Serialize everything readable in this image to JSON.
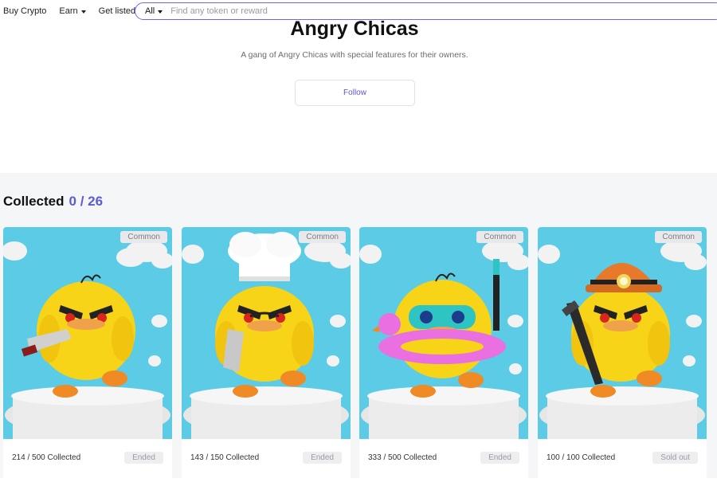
{
  "nav": {
    "items": [
      {
        "label": "Buy Crypto",
        "has_caret": false
      },
      {
        "label": "Earn",
        "has_caret": true
      },
      {
        "label": "Get listed",
        "has_caret": false
      }
    ]
  },
  "search": {
    "filter_value": "All",
    "placeholder": "Find any token or reward"
  },
  "collection": {
    "title": "Angry Chicas",
    "description": "A gang of Angry Chicas with special features for their owners.",
    "follow_label": "Follow"
  },
  "collected": {
    "label": "Collected",
    "count": "0 / 26"
  },
  "cards": [
    {
      "rarity": "Common",
      "collected": "214 / 500 Collected",
      "status": "Ended",
      "accessory": "knife"
    },
    {
      "rarity": "Common",
      "collected": "143 / 150 Collected",
      "status": "Ended",
      "accessory": "chef-hat-cleaver"
    },
    {
      "rarity": "Common",
      "collected": "333 / 500 Collected",
      "status": "Ended",
      "accessory": "snorkel-float"
    },
    {
      "rarity": "Common",
      "collected": "100 / 100 Collected",
      "status": "Sold out",
      "accessory": "miner-helmet-pickaxe"
    }
  ],
  "colors": {
    "accent": "#5b5bd6",
    "search_border": "#6c63ff",
    "band_bg": "#f5f6f8",
    "card_sky": "#5bcbe6",
    "chick_yellow": "#f7d417"
  }
}
